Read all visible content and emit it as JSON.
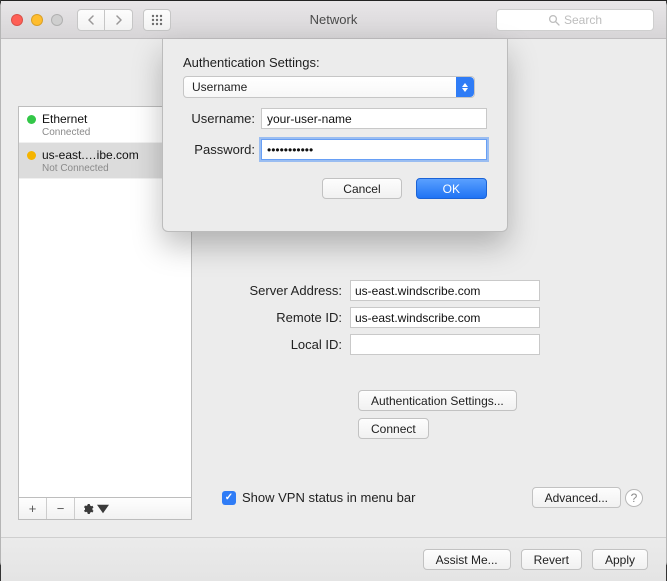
{
  "window": {
    "title": "Network"
  },
  "search": {
    "placeholder": "Search"
  },
  "sidebar": {
    "items": [
      {
        "name": "Ethernet",
        "status": "Connected",
        "color": "green"
      },
      {
        "name": "us-east.…ibe.com",
        "status": "Not Connected",
        "color": "yellow"
      }
    ],
    "footer": {
      "add": "+",
      "remove": "−"
    }
  },
  "detail": {
    "server_label": "Server Address:",
    "server_value": "us-east.windscribe.com",
    "remote_label": "Remote ID:",
    "remote_value": "us-east.windscribe.com",
    "local_label": "Local ID:",
    "local_value": "",
    "auth_button": "Authentication Settings...",
    "connect_button": "Connect",
    "show_vpn_label": "Show VPN status in menu bar",
    "advanced_button": "Advanced..."
  },
  "bottom": {
    "assist": "Assist Me...",
    "revert": "Revert",
    "apply": "Apply"
  },
  "sheet": {
    "title": "Authentication Settings:",
    "auth_type": "Username",
    "username_label": "Username:",
    "username_value": "your-user-name",
    "password_label": "Password:",
    "password_value": "•••••••••••",
    "cancel": "Cancel",
    "ok": "OK"
  }
}
